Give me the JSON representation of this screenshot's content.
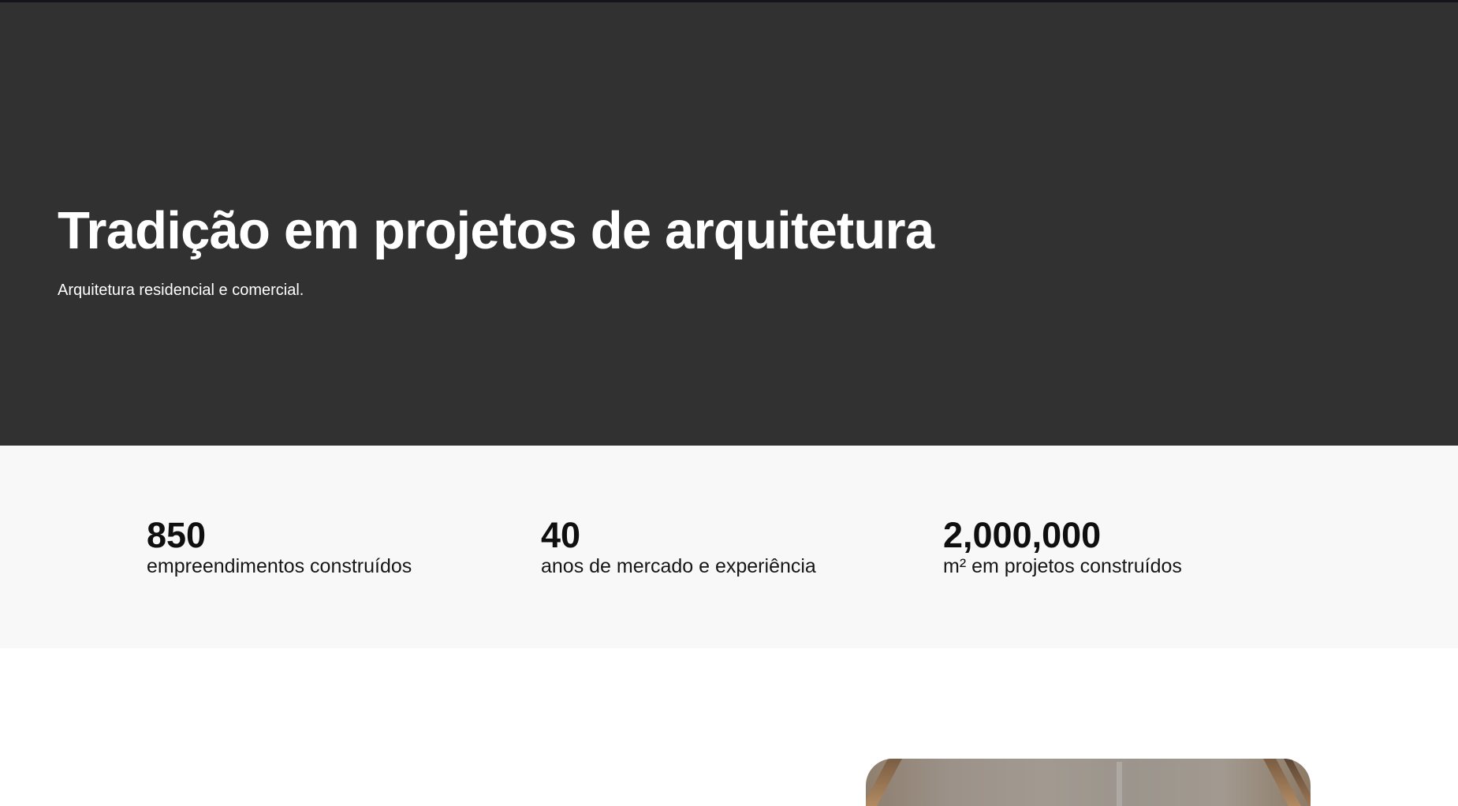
{
  "hero": {
    "title": "Tradição em projetos de arquitetura",
    "subtitle": "Arquitetura residencial e comercial.",
    "background_color": "#313131",
    "text_color": "#ffffff"
  },
  "stats": {
    "background_color": "#f8f8f8",
    "items": [
      {
        "value": "850",
        "label": "empreendimentos construídos"
      },
      {
        "value": "40",
        "label": "anos de mercado e experiência"
      },
      {
        "value": "2,000,000",
        "label": "m² em projetos construídos"
      }
    ]
  },
  "lower_section": {
    "background_color": "#ffffff",
    "image_icon": "architecture-photo"
  }
}
